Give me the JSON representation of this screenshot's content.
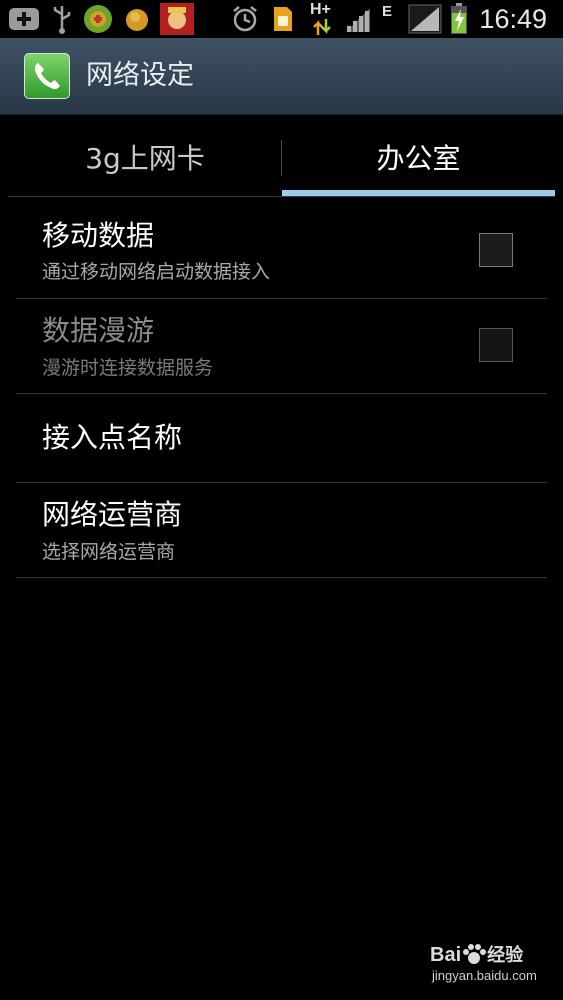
{
  "status_bar": {
    "time": "16:49",
    "network_type": "H+",
    "network_type_2": "E",
    "icons": [
      "add-icon",
      "usb-icon",
      "game-app-icon",
      "coin-icon",
      "mascot-app-icon",
      "alarm-icon",
      "sim-icon",
      "data-arrows-icon",
      "signal-icon",
      "battery-charging-icon"
    ]
  },
  "app_bar": {
    "title": "网络设定",
    "icon": "phone-icon",
    "icon_color": "#4fbf3f"
  },
  "tabs": [
    {
      "label": "3g上网卡",
      "selected": false
    },
    {
      "label": "办公室",
      "selected": true
    }
  ],
  "settings": [
    {
      "title": "移动数据",
      "summary": "通过移动网络启动数据接入",
      "checked": false,
      "enabled": true
    },
    {
      "title": "数据漫游",
      "summary": "漫游时连接数据服务",
      "checked": false,
      "enabled": false
    },
    {
      "title": "接入点名称"
    },
    {
      "title": "网络运营商",
      "summary": "选择网络运营商"
    }
  ],
  "watermark": {
    "brand": "Bai",
    "brand_2": "经验",
    "url": "jingyan.baidu.com"
  },
  "colors": {
    "tab_indicator": "#9dcbea",
    "action_bar": "#34495c",
    "background": "#000000"
  }
}
